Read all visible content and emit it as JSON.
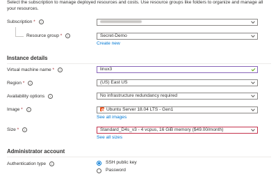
{
  "intro": {
    "line1": "Select the subscription to manage deployed resources and costs. Use resource groups like folders to organize and manage all",
    "line2": "your resources."
  },
  "subscription": {
    "label": "Subscription",
    "required_mark": "*",
    "value": ""
  },
  "resource_group": {
    "label": "Resource group",
    "required_mark": "*",
    "value": "Secret-Demo",
    "create_link": "Create new"
  },
  "instance_details": {
    "heading": "Instance details",
    "vm_name": {
      "label": "Virtual machine name",
      "required_mark": "*",
      "value": "linux3"
    },
    "region": {
      "label": "Region",
      "required_mark": "*",
      "value": "(US) East US"
    },
    "availability": {
      "label": "Availability options",
      "value": "No infrastructure redundancy required"
    },
    "image": {
      "label": "Image",
      "required_mark": "*",
      "value": "Ubuntu Server 18.04 LTS - Gen1",
      "link": "See all images"
    },
    "size": {
      "label": "Size",
      "required_mark": "*",
      "value": "Standard_D4s_v3 - 4 vcpus, 16 GiB memory ($49.00/month)",
      "link": "See all sizes"
    }
  },
  "admin": {
    "heading": "Administrator account",
    "auth_type": {
      "label": "Authentication type",
      "options": [
        "SSH public key",
        "Password"
      ],
      "selected": "SSH public key"
    }
  },
  "icons": {
    "info": "info-icon",
    "chevron": "chevron-down-icon",
    "check": "checkmark-icon",
    "image": "ubuntu-logo-icon"
  },
  "colors": {
    "link": "#0078d4",
    "required": "#a4262c",
    "error_border": "#c4314b",
    "focus_border": "#8764b8"
  }
}
